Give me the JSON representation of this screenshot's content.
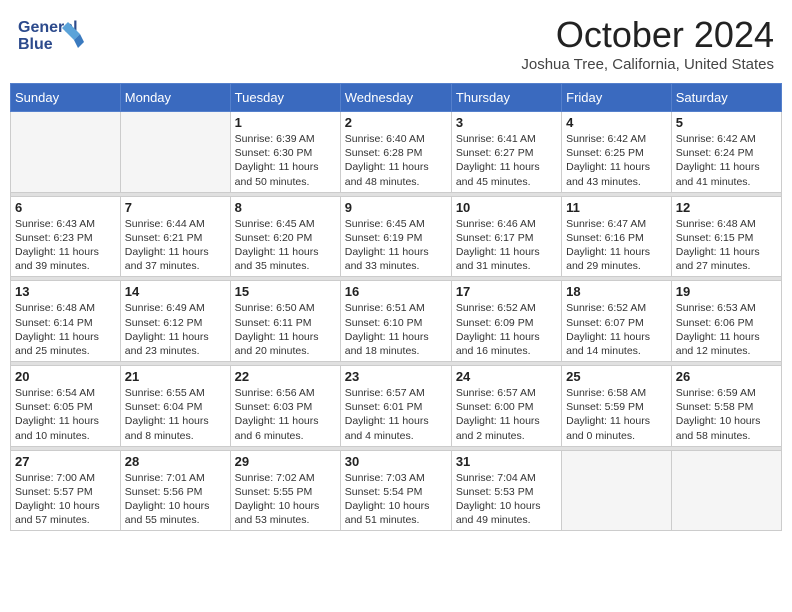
{
  "header": {
    "logo_line1": "General",
    "logo_line2": "Blue",
    "month": "October 2024",
    "location": "Joshua Tree, California, United States"
  },
  "weekdays": [
    "Sunday",
    "Monday",
    "Tuesday",
    "Wednesday",
    "Thursday",
    "Friday",
    "Saturday"
  ],
  "weeks": [
    [
      {
        "day": "",
        "info": ""
      },
      {
        "day": "",
        "info": ""
      },
      {
        "day": "1",
        "info": "Sunrise: 6:39 AM\nSunset: 6:30 PM\nDaylight: 11 hours and 50 minutes."
      },
      {
        "day": "2",
        "info": "Sunrise: 6:40 AM\nSunset: 6:28 PM\nDaylight: 11 hours and 48 minutes."
      },
      {
        "day": "3",
        "info": "Sunrise: 6:41 AM\nSunset: 6:27 PM\nDaylight: 11 hours and 45 minutes."
      },
      {
        "day": "4",
        "info": "Sunrise: 6:42 AM\nSunset: 6:25 PM\nDaylight: 11 hours and 43 minutes."
      },
      {
        "day": "5",
        "info": "Sunrise: 6:42 AM\nSunset: 6:24 PM\nDaylight: 11 hours and 41 minutes."
      }
    ],
    [
      {
        "day": "6",
        "info": "Sunrise: 6:43 AM\nSunset: 6:23 PM\nDaylight: 11 hours and 39 minutes."
      },
      {
        "day": "7",
        "info": "Sunrise: 6:44 AM\nSunset: 6:21 PM\nDaylight: 11 hours and 37 minutes."
      },
      {
        "day": "8",
        "info": "Sunrise: 6:45 AM\nSunset: 6:20 PM\nDaylight: 11 hours and 35 minutes."
      },
      {
        "day": "9",
        "info": "Sunrise: 6:45 AM\nSunset: 6:19 PM\nDaylight: 11 hours and 33 minutes."
      },
      {
        "day": "10",
        "info": "Sunrise: 6:46 AM\nSunset: 6:17 PM\nDaylight: 11 hours and 31 minutes."
      },
      {
        "day": "11",
        "info": "Sunrise: 6:47 AM\nSunset: 6:16 PM\nDaylight: 11 hours and 29 minutes."
      },
      {
        "day": "12",
        "info": "Sunrise: 6:48 AM\nSunset: 6:15 PM\nDaylight: 11 hours and 27 minutes."
      }
    ],
    [
      {
        "day": "13",
        "info": "Sunrise: 6:48 AM\nSunset: 6:14 PM\nDaylight: 11 hours and 25 minutes."
      },
      {
        "day": "14",
        "info": "Sunrise: 6:49 AM\nSunset: 6:12 PM\nDaylight: 11 hours and 23 minutes."
      },
      {
        "day": "15",
        "info": "Sunrise: 6:50 AM\nSunset: 6:11 PM\nDaylight: 11 hours and 20 minutes."
      },
      {
        "day": "16",
        "info": "Sunrise: 6:51 AM\nSunset: 6:10 PM\nDaylight: 11 hours and 18 minutes."
      },
      {
        "day": "17",
        "info": "Sunrise: 6:52 AM\nSunset: 6:09 PM\nDaylight: 11 hours and 16 minutes."
      },
      {
        "day": "18",
        "info": "Sunrise: 6:52 AM\nSunset: 6:07 PM\nDaylight: 11 hours and 14 minutes."
      },
      {
        "day": "19",
        "info": "Sunrise: 6:53 AM\nSunset: 6:06 PM\nDaylight: 11 hours and 12 minutes."
      }
    ],
    [
      {
        "day": "20",
        "info": "Sunrise: 6:54 AM\nSunset: 6:05 PM\nDaylight: 11 hours and 10 minutes."
      },
      {
        "day": "21",
        "info": "Sunrise: 6:55 AM\nSunset: 6:04 PM\nDaylight: 11 hours and 8 minutes."
      },
      {
        "day": "22",
        "info": "Sunrise: 6:56 AM\nSunset: 6:03 PM\nDaylight: 11 hours and 6 minutes."
      },
      {
        "day": "23",
        "info": "Sunrise: 6:57 AM\nSunset: 6:01 PM\nDaylight: 11 hours and 4 minutes."
      },
      {
        "day": "24",
        "info": "Sunrise: 6:57 AM\nSunset: 6:00 PM\nDaylight: 11 hours and 2 minutes."
      },
      {
        "day": "25",
        "info": "Sunrise: 6:58 AM\nSunset: 5:59 PM\nDaylight: 11 hours and 0 minutes."
      },
      {
        "day": "26",
        "info": "Sunrise: 6:59 AM\nSunset: 5:58 PM\nDaylight: 10 hours and 58 minutes."
      }
    ],
    [
      {
        "day": "27",
        "info": "Sunrise: 7:00 AM\nSunset: 5:57 PM\nDaylight: 10 hours and 57 minutes."
      },
      {
        "day": "28",
        "info": "Sunrise: 7:01 AM\nSunset: 5:56 PM\nDaylight: 10 hours and 55 minutes."
      },
      {
        "day": "29",
        "info": "Sunrise: 7:02 AM\nSunset: 5:55 PM\nDaylight: 10 hours and 53 minutes."
      },
      {
        "day": "30",
        "info": "Sunrise: 7:03 AM\nSunset: 5:54 PM\nDaylight: 10 hours and 51 minutes."
      },
      {
        "day": "31",
        "info": "Sunrise: 7:04 AM\nSunset: 5:53 PM\nDaylight: 10 hours and 49 minutes."
      },
      {
        "day": "",
        "info": ""
      },
      {
        "day": "",
        "info": ""
      }
    ]
  ]
}
